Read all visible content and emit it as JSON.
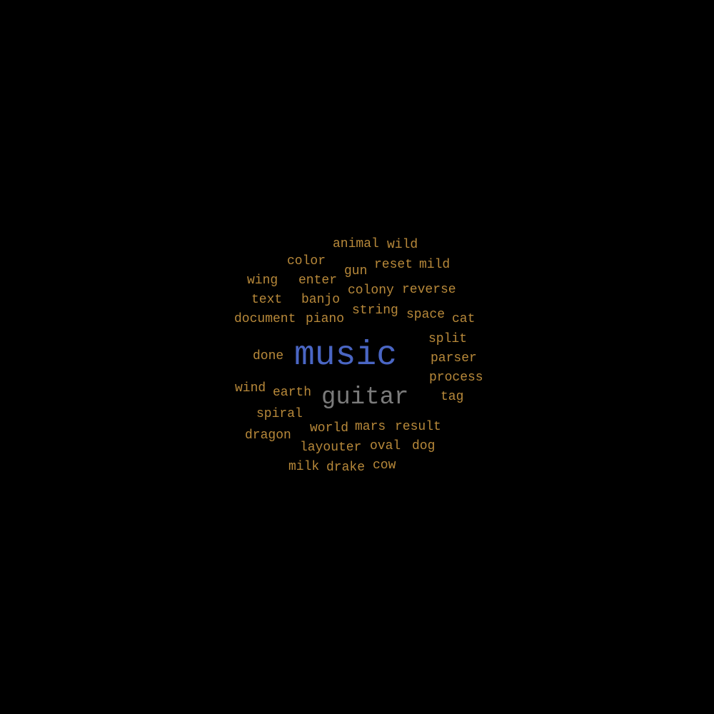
{
  "colors": {
    "background": "#000000",
    "primary": "#4a66c4",
    "secondary": "#7b7b7b",
    "tertiary": "#b8893a"
  },
  "words": [
    {
      "text": "music",
      "tone": "primary"
    },
    {
      "text": "guitar",
      "tone": "secondary"
    },
    {
      "text": "animal",
      "tone": "tertiary"
    },
    {
      "text": "wild",
      "tone": "tertiary"
    },
    {
      "text": "color",
      "tone": "tertiary"
    },
    {
      "text": "gun",
      "tone": "tertiary"
    },
    {
      "text": "reset",
      "tone": "tertiary"
    },
    {
      "text": "mild",
      "tone": "tertiary"
    },
    {
      "text": "wing",
      "tone": "tertiary"
    },
    {
      "text": "enter",
      "tone": "tertiary"
    },
    {
      "text": "colony",
      "tone": "tertiary"
    },
    {
      "text": "reverse",
      "tone": "tertiary"
    },
    {
      "text": "text",
      "tone": "tertiary"
    },
    {
      "text": "banjo",
      "tone": "tertiary"
    },
    {
      "text": "string",
      "tone": "tertiary"
    },
    {
      "text": "space",
      "tone": "tertiary"
    },
    {
      "text": "document",
      "tone": "tertiary"
    },
    {
      "text": "piano",
      "tone": "tertiary"
    },
    {
      "text": "cat",
      "tone": "tertiary"
    },
    {
      "text": "split",
      "tone": "tertiary"
    },
    {
      "text": "done",
      "tone": "tertiary"
    },
    {
      "text": "parser",
      "tone": "tertiary"
    },
    {
      "text": "process",
      "tone": "tertiary"
    },
    {
      "text": "wind",
      "tone": "tertiary"
    },
    {
      "text": "earth",
      "tone": "tertiary"
    },
    {
      "text": "tag",
      "tone": "tertiary"
    },
    {
      "text": "spiral",
      "tone": "tertiary"
    },
    {
      "text": "dragon",
      "tone": "tertiary"
    },
    {
      "text": "world",
      "tone": "tertiary"
    },
    {
      "text": "mars",
      "tone": "tertiary"
    },
    {
      "text": "result",
      "tone": "tertiary"
    },
    {
      "text": "layouter",
      "tone": "tertiary"
    },
    {
      "text": "oval",
      "tone": "tertiary"
    },
    {
      "text": "dog",
      "tone": "tertiary"
    },
    {
      "text": "milk",
      "tone": "tertiary"
    },
    {
      "text": "drake",
      "tone": "tertiary"
    },
    {
      "text": "cow",
      "tone": "tertiary"
    }
  ]
}
